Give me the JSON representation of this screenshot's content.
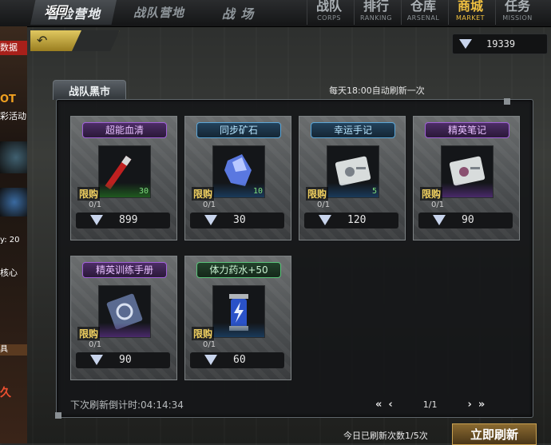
{
  "nav": {
    "tabs": [
      {
        "label": "冒险营地"
      },
      {
        "label": "战队营地"
      },
      {
        "label": "战 场"
      }
    ],
    "menu": [
      {
        "cn": "战队",
        "en": "CORPS"
      },
      {
        "cn": "排行",
        "en": "RANKING"
      },
      {
        "cn": "仓库",
        "en": "ARSENAL"
      },
      {
        "cn": "商城",
        "en": "MARKET"
      },
      {
        "cn": "任务",
        "en": "MISSION"
      }
    ],
    "active": "MARKET"
  },
  "left_strip": {
    "labels": [
      "数据",
      "OT",
      "彩活动",
      "y: 20",
      "核心",
      "具",
      "久"
    ]
  },
  "header": {
    "return_label": "返回",
    "currency": "19339"
  },
  "market": {
    "title": "战队黑市",
    "refresh_note": "每天18:00自动刷新一次",
    "items": [
      {
        "name": "超能血清",
        "qty": "30",
        "limit_label": "限购",
        "limit": "0/1",
        "price": "899",
        "rarity_color": "#a060d8"
      },
      {
        "name": "同步矿石",
        "qty": "10",
        "limit_label": "限购",
        "limit": "0/1",
        "price": "30",
        "rarity_color": "#5aa6d8"
      },
      {
        "name": "幸运手记",
        "qty": "5",
        "limit_label": "限购",
        "limit": "0/1",
        "price": "120",
        "rarity_color": "#5aa6d8"
      },
      {
        "name": "精英笔记",
        "qty": "",
        "limit_label": "限购",
        "limit": "0/1",
        "price": "90",
        "rarity_color": "#a060d8"
      },
      {
        "name": "精英训练手册",
        "qty": "",
        "limit_label": "限购",
        "limit": "0/1",
        "price": "90",
        "rarity_color": "#a060d8"
      },
      {
        "name": "体力药水+50",
        "qty": "",
        "limit_label": "限购",
        "limit": "0/1",
        "price": "60",
        "rarity_color": "#5ac47a"
      }
    ],
    "countdown": "下次刷新倒计时:04:14:34",
    "pager": {
      "first": "«",
      "prev": "‹",
      "page": "1/1",
      "next": "›",
      "last": "»"
    },
    "daily_refresh": "今日已刷新次数1/5次",
    "refresh_button": "立即刷新"
  }
}
